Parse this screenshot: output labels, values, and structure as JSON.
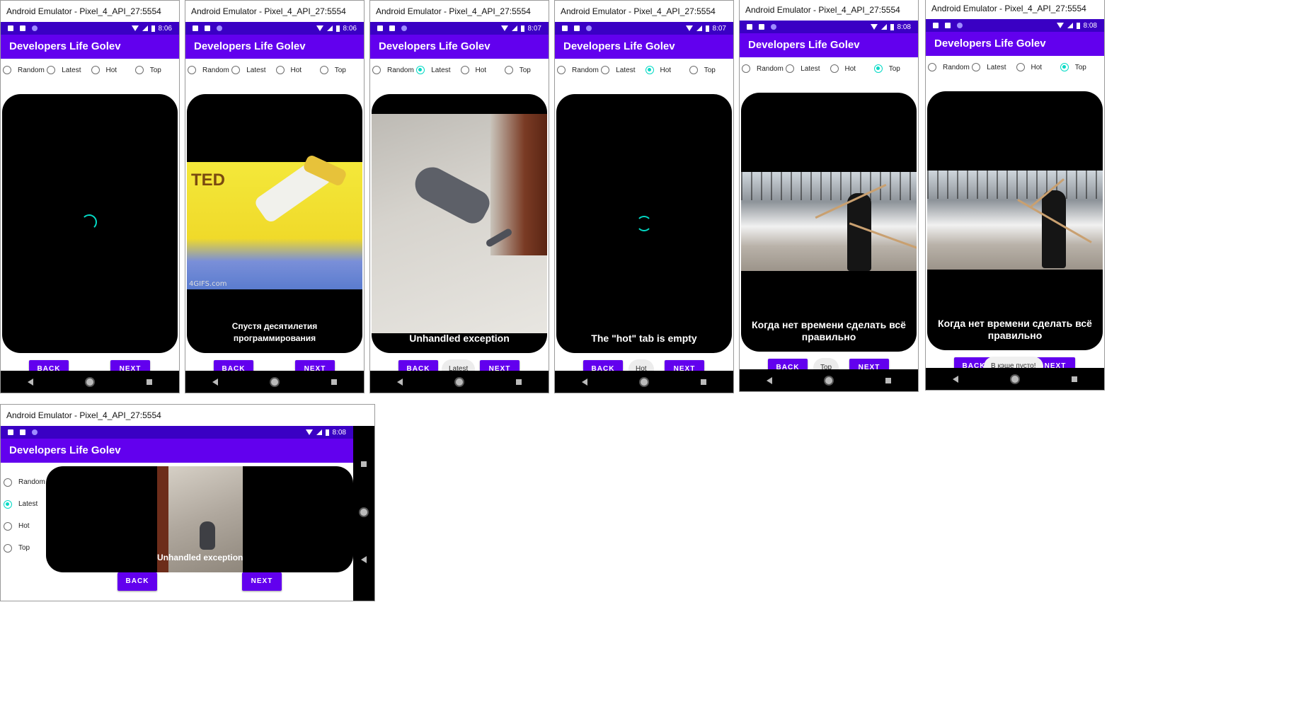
{
  "window_title": "Android Emulator - Pixel_4_API_27:5554",
  "app_title": "Developers Life Golev",
  "radio_labels": [
    "Random",
    "Latest",
    "Hot",
    "Top"
  ],
  "buttons": {
    "back": "BACK",
    "next": "NEXT"
  },
  "colors": {
    "primary": "#6200ee",
    "status_bar": "#3a00c4",
    "accent": "#03dac5"
  },
  "screens": [
    {
      "time": "8:06",
      "selected": "",
      "state": "loading",
      "caption": "",
      "toast": ""
    },
    {
      "time": "8:06",
      "selected": "",
      "state": "gif",
      "gif_text": "TED",
      "watermark": "4GIFS.com",
      "caption": "Спустя десятилетия программирования",
      "toast": ""
    },
    {
      "time": "8:07",
      "selected": "Latest",
      "state": "gif",
      "caption": "Unhandled exception",
      "toast": "Latest"
    },
    {
      "time": "8:07",
      "selected": "Hot",
      "state": "loading",
      "caption": "The \"hot\" tab is empty",
      "toast": "Hot"
    },
    {
      "time": "8:08",
      "selected": "Top",
      "state": "gif",
      "caption": "Когда нет времени сделать всё правильно",
      "toast": "Top"
    },
    {
      "time": "8:08",
      "selected": "Top",
      "state": "gif",
      "caption": "Когда нет времени сделать всё правильно",
      "toast": "В кэше пусто!"
    },
    {
      "time": "8:08",
      "selected": "Latest",
      "state": "gif",
      "caption": "Unhandled exception",
      "toast": "",
      "orientation": "landscape"
    }
  ]
}
